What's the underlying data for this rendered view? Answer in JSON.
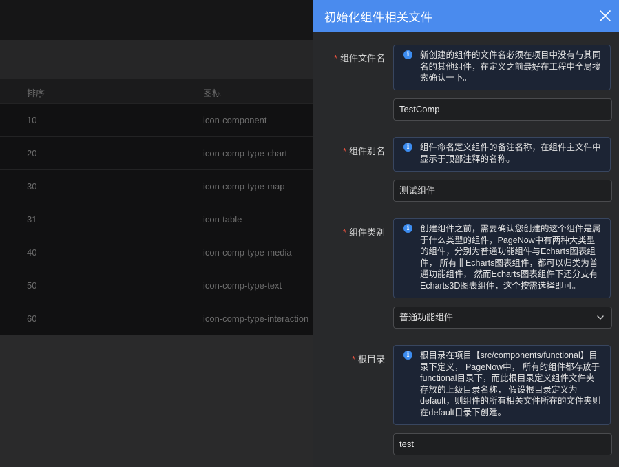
{
  "table": {
    "columns": [
      "排序",
      "图标"
    ],
    "rows": [
      {
        "order": "10",
        "icon": "icon-component"
      },
      {
        "order": "20",
        "icon": "icon-comp-type-chart"
      },
      {
        "order": "30",
        "icon": "icon-comp-type-map"
      },
      {
        "order": "31",
        "icon": "icon-table"
      },
      {
        "order": "40",
        "icon": "icon-comp-type-media"
      },
      {
        "order": "50",
        "icon": "icon-comp-type-text"
      },
      {
        "order": "60",
        "icon": "icon-comp-type-interaction"
      }
    ]
  },
  "drawer": {
    "title": "初始化组件相关文件",
    "close_icon": "close-icon",
    "required_mark": "*",
    "fields": {
      "file_name": {
        "label": "组件文件名",
        "tip": "新创建的组件的文件名必须在项目中没有与其同名的其他组件，在定义之前最好在工程中全局搜索确认一下。",
        "value": "TestComp"
      },
      "alias": {
        "label": "组件别名",
        "tip": "组件命名定义组件的备注名称，在组件主文件中显示于顶部注释的名称。",
        "value": "测试组件"
      },
      "category": {
        "label": "组件类别",
        "tip": "创建组件之前，需要确认您创建的这个组件是属于什么类型的组件，PageNow中有两种大类型的组件，分别为普通功能组件与Echarts图表组件， 所有非Echarts图表组件，都可以归类为普通功能组件， 然而Echarts图表组件下还分支有Echarts3D图表组件，这个按需选择即可。",
        "value": "普通功能组件"
      },
      "root_dir": {
        "label": "根目录",
        "tip": "根目录在项目【src/components/functional】目录下定义， PageNow中， 所有的组件都存放于functional目录下，而此根目录定义组件文件夹存放的上级目录名称， 假设根目录定义为default，则组件的所有相关文件所在的文件夹则在default目录下创建。",
        "value": "test"
      }
    },
    "info_icon": "i",
    "colors": {
      "header": "#4a8bee",
      "info_bg": "#1c2434",
      "info_icon": "#3c8cf0",
      "required": "#e8523f"
    }
  }
}
